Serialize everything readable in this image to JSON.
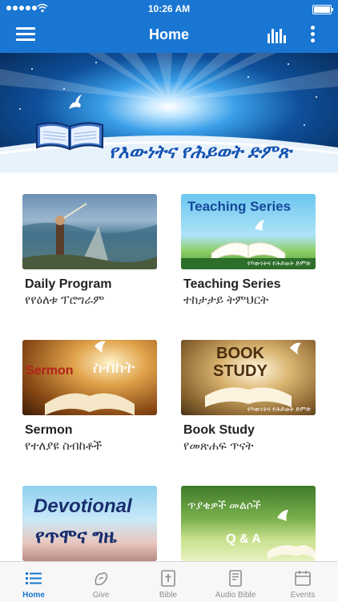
{
  "status": {
    "time": "10:26 AM"
  },
  "header": {
    "title": "Home"
  },
  "banner": {
    "title": "የእውነትና የሕይወት ድምጽ"
  },
  "cards": [
    {
      "title": "Daily Program",
      "subtitle": "የየዕለቱ ፕሮግራም"
    },
    {
      "title": "Teaching Series",
      "subtitle": "ተከታታይ ትምህርት",
      "image_text": "Teaching Series",
      "image_caption": "የእውነትና የሕይወት ድምጽ"
    },
    {
      "title": "Sermon",
      "subtitle": "የተለያዩ ስብከቶች",
      "image_text": "Sermon",
      "image_text_am": "ስብከት"
    },
    {
      "title": "Book Study",
      "subtitle": "የመጽሐፍ ጥናት",
      "image_text_line1": "BOOK",
      "image_text_line2": "STUDY",
      "image_caption": "የእውነትና የሕይወት ድምጽ"
    },
    {
      "image_text": "Devotional",
      "image_text_am": "የጥሞና ግዜ"
    },
    {
      "image_text_am": "ጥያቄዎች መልሶች",
      "image_text": "Q & A"
    }
  ],
  "tabs": [
    {
      "label": "Home",
      "icon": "list-icon",
      "active": true
    },
    {
      "label": "Give",
      "icon": "hand-heart-icon"
    },
    {
      "label": "Bible",
      "icon": "bible-cross-icon"
    },
    {
      "label": "Audio Bible",
      "icon": "book-icon"
    },
    {
      "label": "Events",
      "icon": "calendar-icon"
    }
  ],
  "colors": {
    "primary": "#1976d2",
    "tab_inactive": "#8e8e93"
  }
}
